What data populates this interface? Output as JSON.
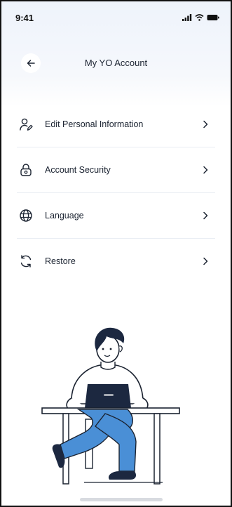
{
  "status_bar": {
    "time": "9:41"
  },
  "header": {
    "title": "My YO Account"
  },
  "menu": {
    "items": [
      {
        "label": "Edit Personal Information",
        "icon": "user-edit-icon"
      },
      {
        "label": "Account Security",
        "icon": "lock-icon"
      },
      {
        "label": "Language",
        "icon": "globe-icon"
      },
      {
        "label": "Restore",
        "icon": "refresh-icon"
      }
    ]
  },
  "colors": {
    "ink": "#1b2331",
    "accent_blue": "#4a8fd6",
    "navy": "#1c2840",
    "divider": "#e9edf3",
    "header_bg": "#eef3fb"
  }
}
